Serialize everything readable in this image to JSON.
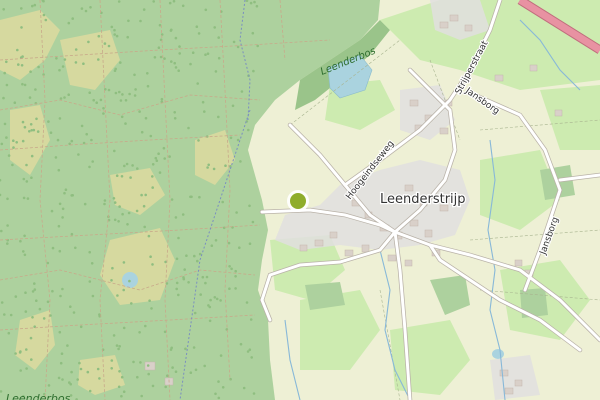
{
  "map": {
    "place_label": "Leenderstrijp",
    "forest_label_top": "Leenderbos",
    "forest_label_bottom": "Leenderbos",
    "roads": {
      "hoogeindseweg": "Hoogeindseweg",
      "strijperstraat": "Strijperstraat",
      "jansborg_1": "Jansborg",
      "jansborg_2": "Jansborg"
    },
    "colors": {
      "forest": "#add19e",
      "forest_dark": "#9ac48a",
      "heath": "#d6d99f",
      "farmland": "#eef0d5",
      "meadow": "#cdebb0",
      "water": "#aad3df",
      "residential": "#e0dfdf",
      "building": "#d9d0c9",
      "road": "#ffffff",
      "motorway": "#e892a2",
      "marker": "#8fad2b"
    }
  }
}
